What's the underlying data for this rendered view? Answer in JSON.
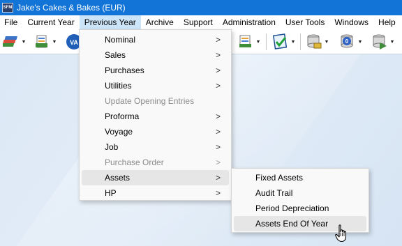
{
  "window": {
    "title": "Jake's Cakes & Bakes (EUR)",
    "app_icon_text": "SFM"
  },
  "menubar": {
    "items": [
      {
        "label": "File"
      },
      {
        "label": "Current Year"
      },
      {
        "label": "Previous Year"
      },
      {
        "label": "Archive"
      },
      {
        "label": "Support"
      },
      {
        "label": "Administration"
      },
      {
        "label": "User Tools"
      },
      {
        "label": "Windows"
      },
      {
        "label": "Help"
      }
    ]
  },
  "toolbar": {
    "icons": [
      "ledger-stack-icon",
      "document-edit-icon",
      "vat-icon",
      "reports-icon",
      "checkmark-document-icon",
      "database-icon",
      "database-info-icon",
      "database-export-icon"
    ]
  },
  "previous_year_menu": {
    "items": [
      {
        "label": "Nominal",
        "has_submenu": true,
        "enabled": true
      },
      {
        "label": "Sales",
        "has_submenu": true,
        "enabled": true
      },
      {
        "label": "Purchases",
        "has_submenu": true,
        "enabled": true
      },
      {
        "label": "Utilities",
        "has_submenu": true,
        "enabled": true
      },
      {
        "label": "Update Opening Entries",
        "has_submenu": false,
        "enabled": false
      },
      {
        "label": "Proforma",
        "has_submenu": true,
        "enabled": true
      },
      {
        "label": "Voyage",
        "has_submenu": true,
        "enabled": true
      },
      {
        "label": "Job",
        "has_submenu": true,
        "enabled": true
      },
      {
        "label": "Purchase Order",
        "has_submenu": true,
        "enabled": false
      },
      {
        "label": "Assets",
        "has_submenu": true,
        "enabled": true,
        "highlighted": true
      },
      {
        "label": "HP",
        "has_submenu": true,
        "enabled": true
      }
    ],
    "arrow_glyph": ">"
  },
  "assets_submenu": {
    "items": [
      {
        "label": "Fixed Assets"
      },
      {
        "label": "Audit Trail"
      },
      {
        "label": "Period Depreciation"
      },
      {
        "label": "Assets End Of Year",
        "highlighted": true
      }
    ]
  },
  "colors": {
    "titlebar": "#1174d6",
    "menu_active": "#cce4f7",
    "menu_highlight": "#e6e6e6",
    "workspace": "#dce8f5"
  }
}
